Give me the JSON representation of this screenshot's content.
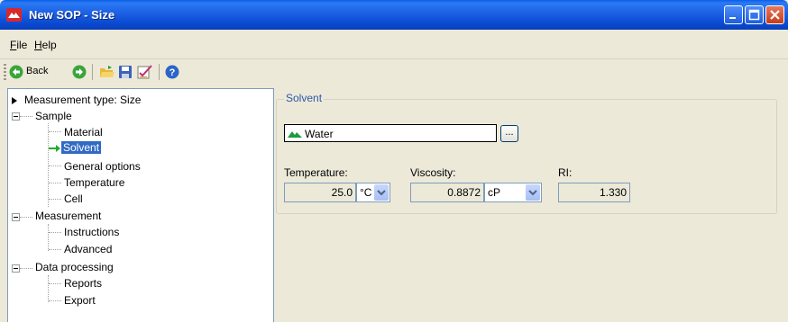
{
  "window": {
    "title": "New SOP - Size"
  },
  "menu": {
    "file": "File",
    "file_mnemonic": "F",
    "file_rest": "ile",
    "help_mnemonic": "H",
    "help_rest": "elp"
  },
  "toolbar": {
    "back_label": "Back"
  },
  "tree": {
    "root": "Measurement type: Size",
    "sample": "Sample",
    "material": "Material",
    "solvent": "Solvent",
    "general_options": "General options",
    "temperature": "Temperature",
    "cell": "Cell",
    "measurement": "Measurement",
    "instructions": "Instructions",
    "advanced": "Advanced",
    "data_processing": "Data processing",
    "reports": "Reports",
    "export": "Export"
  },
  "solvent_panel": {
    "group_title": "Solvent",
    "solvent_value": "Water",
    "browse_label": "...",
    "temperature_label": "Temperature:",
    "temperature_value": "25.0",
    "temperature_unit": "°C",
    "viscosity_label": "Viscosity:",
    "viscosity_value": "0.8872",
    "viscosity_unit": "cP",
    "ri_label": "RI:",
    "ri_value": "1.330"
  },
  "colors": {
    "titlebar": "#0a49d0",
    "selection": "#316ac5",
    "group_title": "#2c5aa8",
    "panel_bg": "#ece9d8"
  }
}
